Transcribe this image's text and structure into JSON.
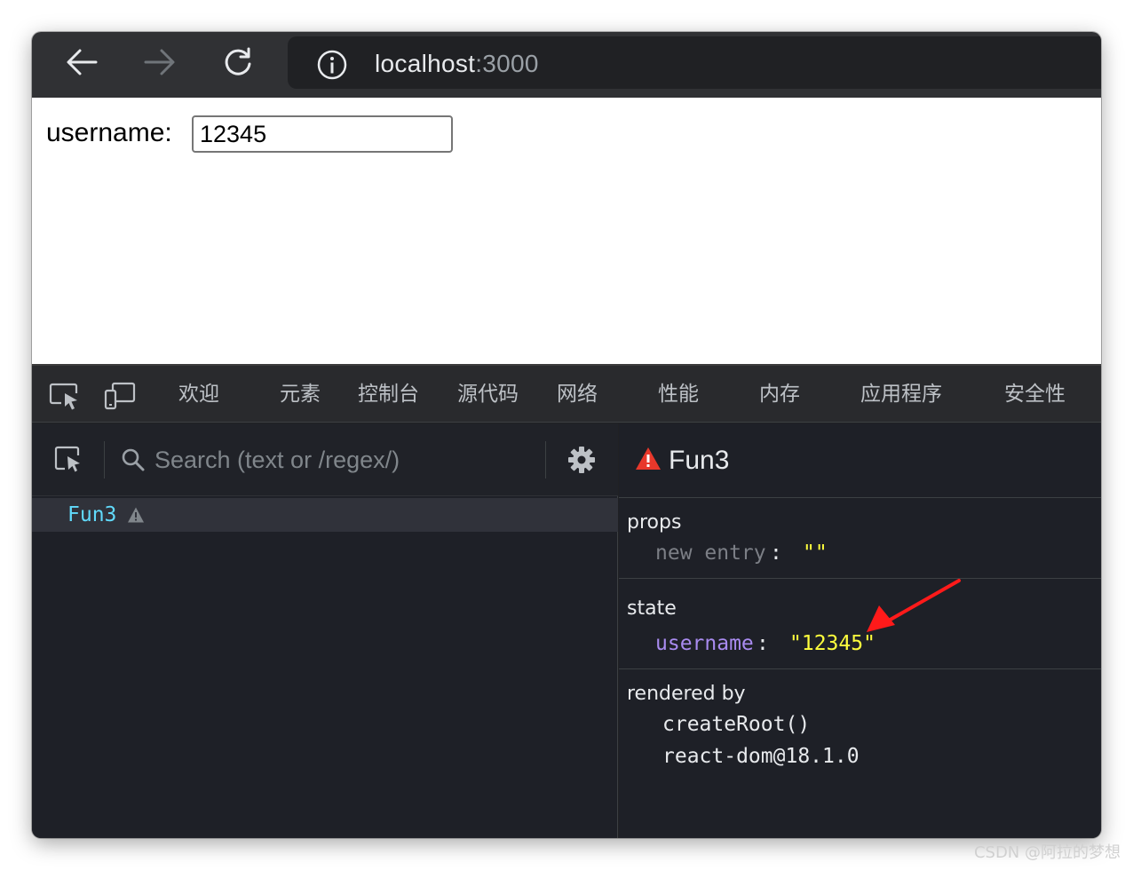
{
  "browser": {
    "url_host": "localhost",
    "url_port": ":3000",
    "icons": {
      "back": "arrow-left-icon",
      "forward": "arrow-right-icon",
      "reload": "reload-icon",
      "site_info": "info-icon"
    }
  },
  "page": {
    "username_label": "username:",
    "username_value": "12345"
  },
  "devtools": {
    "tabs": [
      "欢迎",
      "元素",
      "控制台",
      "源代码",
      "网络",
      "性能",
      "内存",
      "应用程序",
      "安全性"
    ],
    "search_placeholder": "Search (text or /regex/)",
    "tree": {
      "component": "Fun3"
    },
    "selected_component": "Fun3",
    "props": {
      "label": "props",
      "key": "new entry",
      "colon": ":",
      "value": "\"\""
    },
    "state": {
      "label": "state",
      "key": "username",
      "colon": ":",
      "value": "\"12345\""
    },
    "rendered_by": {
      "label": "rendered by",
      "items": [
        "createRoot()",
        "react-dom@18.1.0"
      ]
    },
    "colors": {
      "react_blue": "#61dafb",
      "string_yellow": "#ffff3d",
      "key_purple": "#a98bf0",
      "error_red": "#e8382b"
    }
  },
  "annotation": {
    "arrow_color": "#ff1a1a"
  },
  "watermark": "CSDN @阿拉的梦想"
}
